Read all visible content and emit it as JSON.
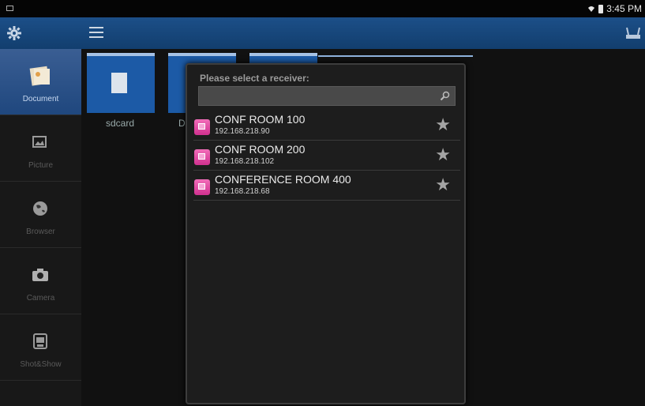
{
  "status_bar": {
    "time": "3:45 PM"
  },
  "sidebar": {
    "items": [
      {
        "label": "Document",
        "active": true
      },
      {
        "label": "Picture",
        "active": false
      },
      {
        "label": "Browser",
        "active": false
      },
      {
        "label": "Camera",
        "active": false
      },
      {
        "label": "Shot&Show",
        "active": false
      }
    ]
  },
  "content": {
    "tiles": [
      {
        "label": "sdcard"
      },
      {
        "label": "D"
      }
    ]
  },
  "dialog": {
    "title": "Please select a receiver:",
    "search_value": "",
    "receivers": [
      {
        "name": "CONF ROOM 100",
        "ip": "192.168.218.90"
      },
      {
        "name": "CONF ROOM 200",
        "ip": "192.168.218.102"
      },
      {
        "name": "CONFERENCE ROOM 400",
        "ip": "192.168.218.68"
      }
    ]
  },
  "colors": {
    "topbar": "#1c4f88",
    "sidebar_active": "#2c5289",
    "device_icon": "#e04aa3"
  }
}
